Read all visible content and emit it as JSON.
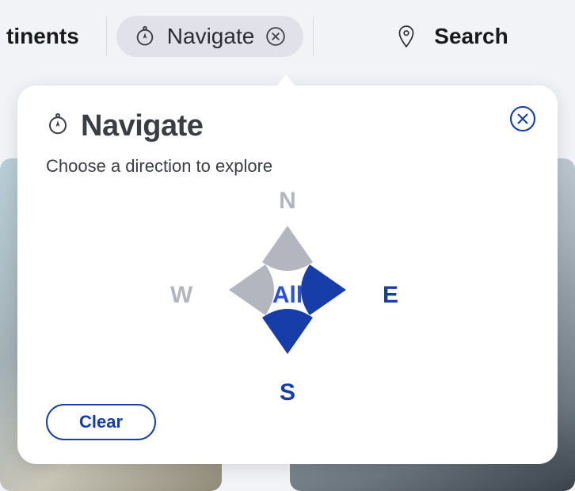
{
  "tabs": {
    "continents_partial": "tinents",
    "navigate": "Navigate",
    "search": "Search"
  },
  "panel": {
    "title": "Navigate",
    "subtitle": "Choose a direction to explore",
    "center": "All",
    "n": "N",
    "s": "S",
    "e": "E",
    "w": "W",
    "clear": "Clear"
  },
  "icons": {
    "compass": "compass-icon",
    "pin": "pin-icon",
    "close_tab": "close-icon",
    "close_panel": "close-icon"
  },
  "colors": {
    "accent": "#173ea8",
    "accent_light": "#2d52d0",
    "muted": "#b4b6bf"
  }
}
